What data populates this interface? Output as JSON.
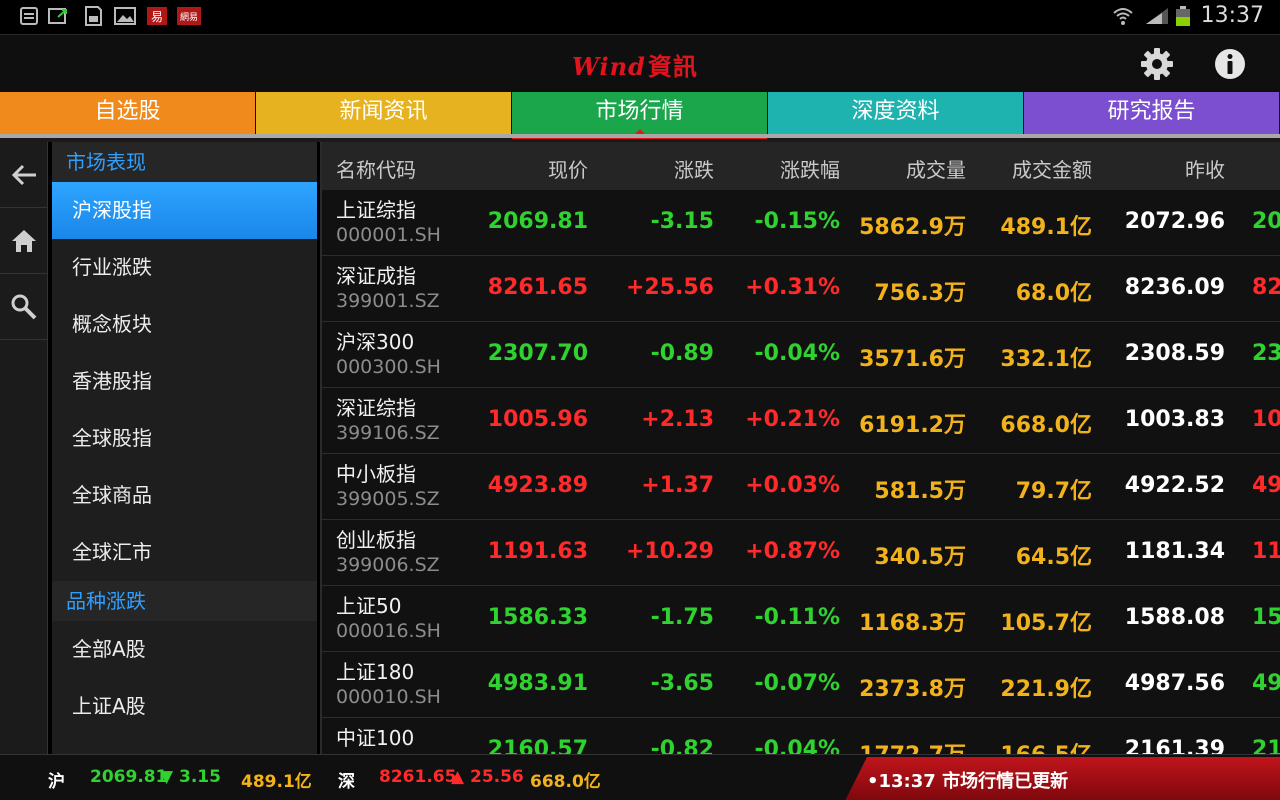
{
  "status": {
    "time": "13:37"
  },
  "header": {
    "logo_en": "Wind",
    "logo_cn": "資訊"
  },
  "tabs": [
    {
      "label": "自选股",
      "color": "#f08a1c"
    },
    {
      "label": "新闻资讯",
      "color": "#e7b21f"
    },
    {
      "label": "市场行情",
      "color": "#1ba64c"
    },
    {
      "label": "深度资料",
      "color": "#1fb3b0"
    },
    {
      "label": "研究报告",
      "color": "#7b4fd0"
    }
  ],
  "sidebar": {
    "section1": "市场表现",
    "items1": [
      "沪深股指",
      "行业涨跌",
      "概念板块",
      "香港股指",
      "全球股指",
      "全球商品",
      "全球汇市"
    ],
    "section2": "品种涨跌",
    "items2": [
      "全部A股",
      "上证A股"
    ]
  },
  "table": {
    "headers": [
      "名称代码",
      "现价",
      "涨跌",
      "涨跌幅",
      "成交量",
      "成交金额",
      "昨收"
    ],
    "rows": [
      {
        "name": "上证综指",
        "code": "000001.SH",
        "price": "2069.81",
        "change": "-3.15",
        "pct": "-0.15%",
        "volume": "5862.9万",
        "amount": "489.1亿",
        "prev": "2072.96",
        "extra": "20",
        "dir": "down"
      },
      {
        "name": "深证成指",
        "code": "399001.SZ",
        "price": "8261.65",
        "change": "+25.56",
        "pct": "+0.31%",
        "volume": "756.3万",
        "amount": "68.0亿",
        "prev": "8236.09",
        "extra": "82",
        "dir": "up"
      },
      {
        "name": "沪深300",
        "code": "000300.SH",
        "price": "2307.70",
        "change": "-0.89",
        "pct": "-0.04%",
        "volume": "3571.6万",
        "amount": "332.1亿",
        "prev": "2308.59",
        "extra": "23",
        "dir": "down"
      },
      {
        "name": "深证综指",
        "code": "399106.SZ",
        "price": "1005.96",
        "change": "+2.13",
        "pct": "+0.21%",
        "volume": "6191.2万",
        "amount": "668.0亿",
        "prev": "1003.83",
        "extra": "10",
        "dir": "up"
      },
      {
        "name": "中小板指",
        "code": "399005.SZ",
        "price": "4923.89",
        "change": "+1.37",
        "pct": "+0.03%",
        "volume": "581.5万",
        "amount": "79.7亿",
        "prev": "4922.52",
        "extra": "49",
        "dir": "up"
      },
      {
        "name": "创业板指",
        "code": "399006.SZ",
        "price": "1191.63",
        "change": "+10.29",
        "pct": "+0.87%",
        "volume": "340.5万",
        "amount": "64.5亿",
        "prev": "1181.34",
        "extra": "11",
        "dir": "up"
      },
      {
        "name": "上证50",
        "code": "000016.SH",
        "price": "1586.33",
        "change": "-1.75",
        "pct": "-0.11%",
        "volume": "1168.3万",
        "amount": "105.7亿",
        "prev": "1588.08",
        "extra": "15",
        "dir": "down"
      },
      {
        "name": "上证180",
        "code": "000010.SH",
        "price": "4983.91",
        "change": "-3.65",
        "pct": "-0.07%",
        "volume": "2373.8万",
        "amount": "221.9亿",
        "prev": "4987.56",
        "extra": "49",
        "dir": "down"
      },
      {
        "name": "中证100",
        "code": "",
        "price": "2160.57",
        "change": "-0.82",
        "pct": "-0.04%",
        "volume": "1772.7万",
        "amount": "166.5亿",
        "prev": "2161.39",
        "extra": "21",
        "dir": "down"
      }
    ]
  },
  "bottom": {
    "sh_label": "沪",
    "sh_price": "2069.81",
    "sh_change": "▼ 3.15",
    "sh_amount": "489.1亿",
    "sz_label": "深",
    "sz_price": "8261.65",
    "sz_change": "▲ 25.56",
    "sz_amount": "668.0亿",
    "alert": "•13:37 市场行情已更新"
  },
  "colors": {
    "up": "#ff2a2a",
    "down": "#2fd22f",
    "volume": "#f2b21c",
    "accent": "#2f9fff"
  }
}
